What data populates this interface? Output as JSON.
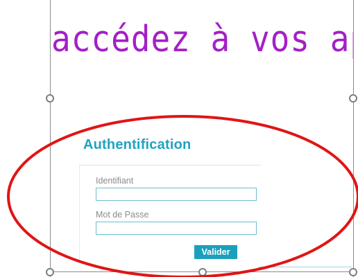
{
  "header": {
    "title": "accédez à vos applications"
  },
  "auth": {
    "title": "Authentification",
    "identifier_label": "Identifiant",
    "identifier_value": "",
    "password_label": "Mot de Passe",
    "password_value": "",
    "submit_label": "Valider"
  },
  "colors": {
    "title": "#a41fc7",
    "accent": "#1aa0bd",
    "annotation": "#e01515"
  }
}
